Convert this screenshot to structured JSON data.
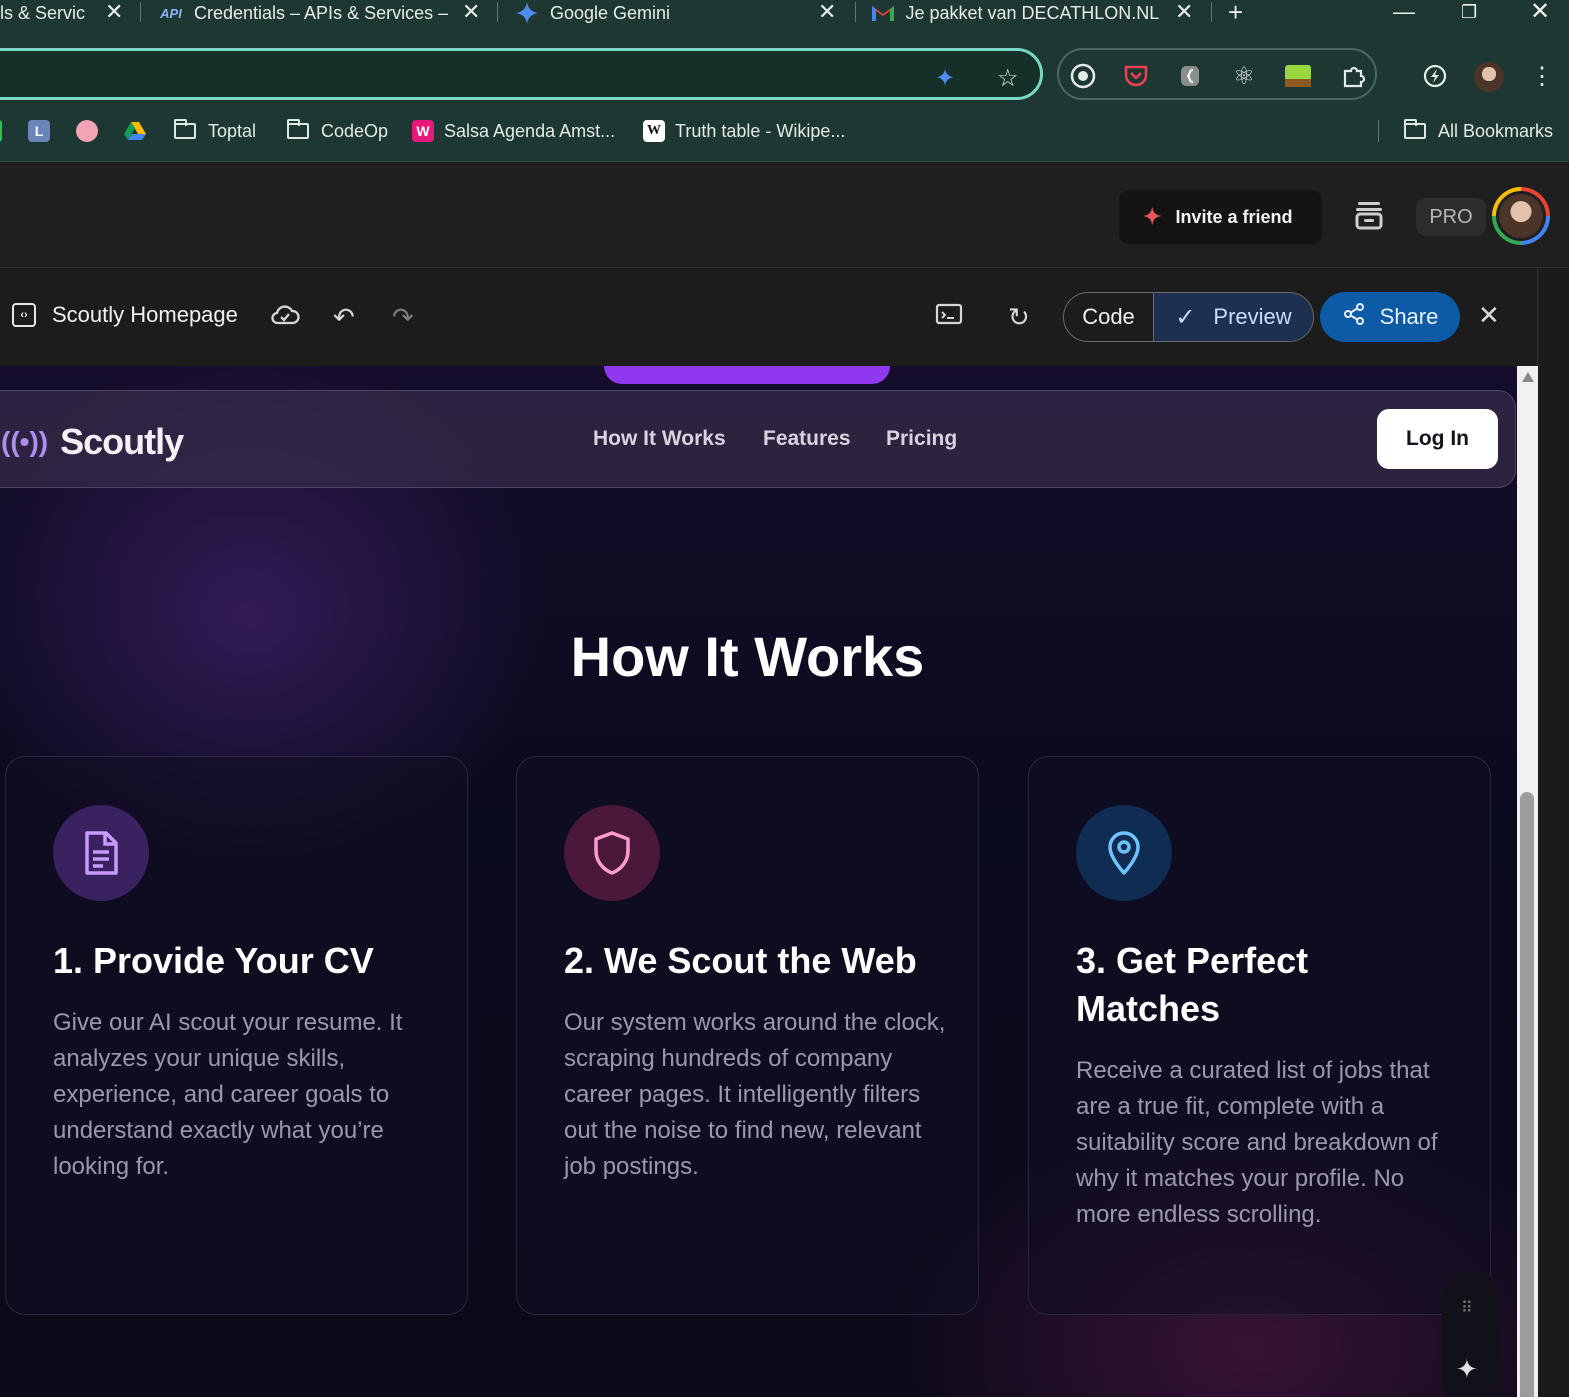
{
  "browser": {
    "tabs": [
      {
        "title": "ls & Servic",
        "favicon": "google-cloud-icon"
      },
      {
        "title": "Credentials – APIs & Services –",
        "favicon": "api-icon",
        "favicon_text": "API"
      },
      {
        "title": "Google Gemini",
        "favicon": "gemini-icon"
      },
      {
        "title": "Je pakket van DECATHLON.NL i",
        "favicon": "gmail-icon"
      }
    ],
    "new_tab": "+",
    "bookmarks": [
      {
        "label": "Toptal",
        "type": "folder"
      },
      {
        "label": "CodeOp",
        "type": "folder"
      },
      {
        "label": "Salsa Agenda Amst...",
        "type": "link",
        "icon_text": "W"
      },
      {
        "label": "Truth table - Wikipe...",
        "type": "link",
        "icon_text": "W"
      }
    ],
    "all_bookmarks": "All Bookmarks"
  },
  "app": {
    "invite_label": "Invite a friend",
    "pro_label": "PRO",
    "canvas_title": "Scoutly Homepage",
    "code_label": "Code",
    "preview_label": "Preview",
    "share_label": "Share"
  },
  "site": {
    "brand": "Scoutly",
    "nav": [
      "How It Works",
      "Features",
      "Pricing"
    ],
    "login": "Log In",
    "section_title": "How It Works",
    "cards": [
      {
        "title": "1. Provide Your CV",
        "body": "Give our AI scout your resume. It analyzes your unique skills, experience, and career goals to understand exactly what you’re looking for.",
        "icon": "document-icon",
        "accent": "#c79bff"
      },
      {
        "title": "2. We Scout the Web",
        "body": "Our system works around the clock, scraping hundreds of company career pages. It intelligently filters out the noise to find new, relevant job postings.",
        "icon": "shield-icon",
        "accent": "#ff9ccf"
      },
      {
        "title": "3. Get Perfect Matches",
        "body": "Receive a curated list of jobs that are a true fit, complete with a suitability score and breakdown of why it matches your profile. No more endless scrolling.",
        "icon": "location-pin-icon",
        "accent": "#6ec3ff"
      }
    ]
  },
  "colors": {
    "browser_chrome": "#1d3732",
    "omnibox_border": "#79d7c4",
    "share_blue": "#0d5aa7",
    "brand_purple": "#8f38f0"
  }
}
